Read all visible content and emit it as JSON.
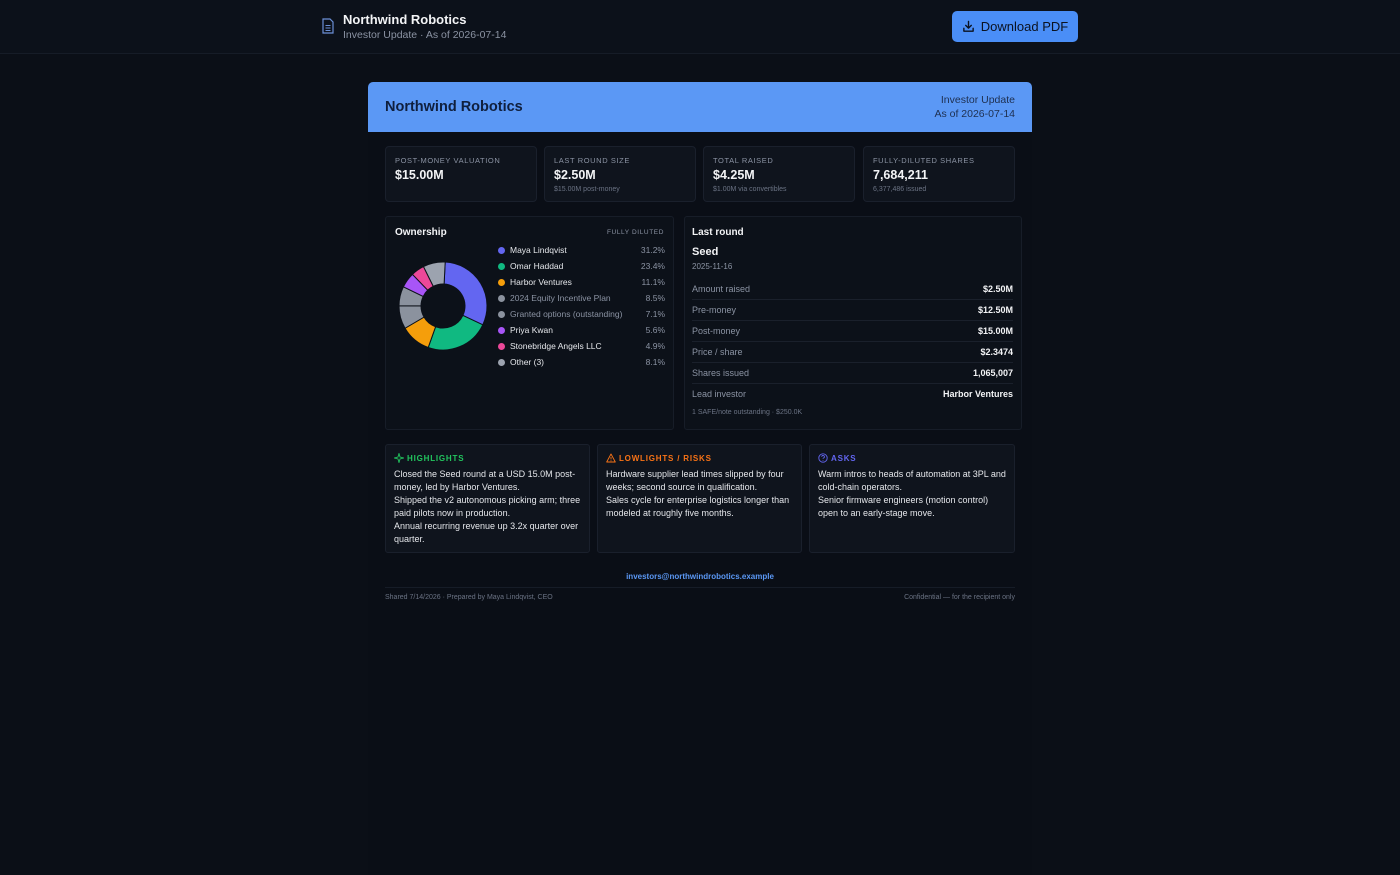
{
  "topbar": {
    "title": "Northwind Robotics",
    "subtitle": "Investor Update · As of 2026-07-14",
    "download_label": "Download PDF",
    "icon": "document-icon"
  },
  "banner": {
    "title": "Northwind Robotics",
    "line1": "Investor Update",
    "line2": "As of 2026-07-14"
  },
  "kpis": [
    {
      "label": "Post-money valuation",
      "value": "$15.00M",
      "sub": ""
    },
    {
      "label": "Last round size",
      "value": "$2.50M",
      "sub": "$15.00M post-money"
    },
    {
      "label": "Total raised",
      "value": "$4.25M",
      "sub": "$1.00M via convertibles"
    },
    {
      "label": "Fully-diluted shares",
      "value": "7,684,211",
      "sub": "6,377,486 issued"
    }
  ],
  "ownership": {
    "title": "Ownership",
    "tag": "Fully diluted",
    "holders": [
      {
        "name": "Maya Lindqvist",
        "pct": "31.2%",
        "value": 31.2,
        "color": "#6366f1",
        "muted": false
      },
      {
        "name": "Omar Haddad",
        "pct": "23.4%",
        "value": 23.4,
        "color": "#10b981",
        "muted": false
      },
      {
        "name": "Harbor Ventures",
        "pct": "11.1%",
        "value": 11.1,
        "color": "#f59e0b",
        "muted": false
      },
      {
        "name": "2024 Equity Incentive Plan",
        "pct": "8.5%",
        "value": 8.5,
        "color": "#8b929e",
        "muted": true
      },
      {
        "name": "Granted options (outstanding)",
        "pct": "7.1%",
        "value": 7.1,
        "color": "#8b929e",
        "muted": true
      },
      {
        "name": "Priya Kwan",
        "pct": "5.6%",
        "value": 5.6,
        "color": "#a855f7",
        "muted": false
      },
      {
        "name": "Stonebridge Angels LLC",
        "pct": "4.9%",
        "value": 4.9,
        "color": "#ec4899",
        "muted": false
      },
      {
        "name": "Other (3)",
        "pct": "8.1%",
        "value": 8.1,
        "color": "#9ca3af",
        "muted": false
      }
    ]
  },
  "last_round": {
    "title": "Last round",
    "stage": "Seed",
    "date": "2025-11-16",
    "rows": [
      {
        "key": "Amount raised",
        "value": "$2.50M"
      },
      {
        "key": "Pre-money",
        "value": "$12.50M"
      },
      {
        "key": "Post-money",
        "value": "$15.00M"
      },
      {
        "key": "Price / share",
        "value": "$2.3474"
      },
      {
        "key": "Shares issued",
        "value": "1,065,007"
      },
      {
        "key": "Lead investor",
        "value": "Harbor Ventures"
      }
    ],
    "note": "1 SAFE/note outstanding · $250.0K"
  },
  "sections": {
    "highlights": {
      "title": "Highlights",
      "color": "#22c55e",
      "items": [
        "Closed the Seed round at a USD 15.0M post-money, led by Harbor Ventures.",
        "Shipped the v2 autonomous picking arm; three paid pilots now in production.",
        "Annual recurring revenue up 3.2x quarter over quarter."
      ]
    },
    "lowlights": {
      "title": "Lowlights / Risks",
      "color": "#f97316",
      "items": [
        "Hardware supplier lead times slipped by four weeks; second source in qualification.",
        "Sales cycle for enterprise logistics longer than modeled at roughly five months."
      ]
    },
    "asks": {
      "title": "Asks",
      "color": "#6366f1",
      "items": [
        "Warm intros to heads of automation at 3PL and cold-chain operators.",
        "Senior firmware engineers (motion control) open to an early-stage move."
      ]
    }
  },
  "footer": {
    "contact": "investors@northwindrobotics.example",
    "left": "Shared 7/14/2026 · Prepared by Maya Lindqvist, CEO",
    "right": "Confidential — for the recipient only"
  }
}
